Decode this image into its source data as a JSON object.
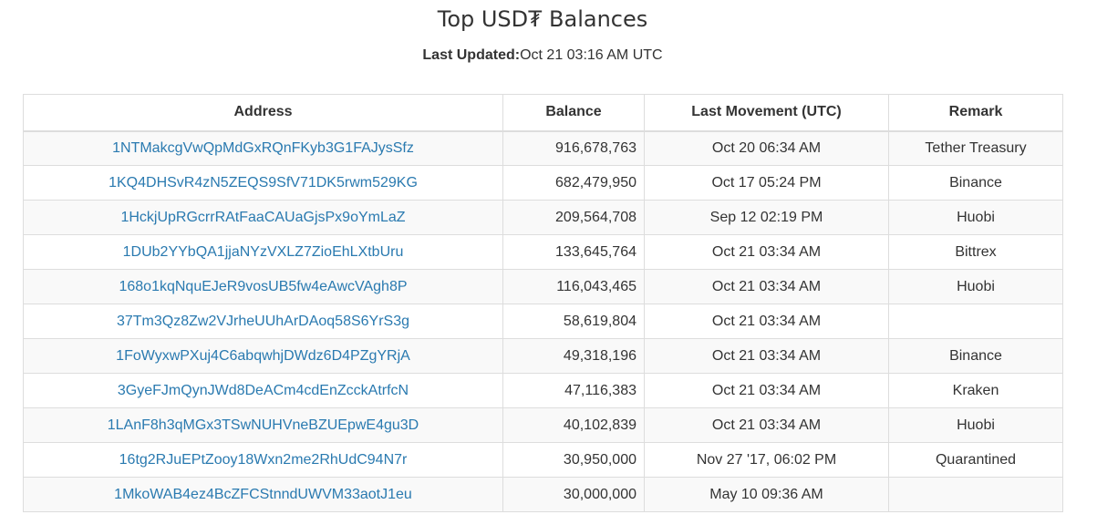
{
  "page": {
    "title": "Top USD₮ Balances",
    "updated_label": "Last Updated:",
    "updated_value": "Oct 21 03:16 AM UTC"
  },
  "table": {
    "headers": [
      "Address",
      "Balance",
      "Last Movement (UTC)",
      "Remark"
    ],
    "rows": [
      {
        "address": "1NTMakcgVwQpMdGxRQnFKyb3G1FAJysSfz",
        "balance": "916,678,763",
        "last_movement": "Oct 20 06:34 AM",
        "remark": "Tether Treasury"
      },
      {
        "address": "1KQ4DHSvR4zN5ZEQS9SfV71DK5rwm529KG",
        "balance": "682,479,950",
        "last_movement": "Oct 17 05:24 PM",
        "remark": "Binance"
      },
      {
        "address": "1HckjUpRGcrrRAtFaaCAUaGjsPx9oYmLaZ",
        "balance": "209,564,708",
        "last_movement": "Sep 12 02:19 PM",
        "remark": "Huobi"
      },
      {
        "address": "1DUb2YYbQA1jjaNYzVXLZ7ZioEhLXtbUru",
        "balance": "133,645,764",
        "last_movement": "Oct 21 03:34 AM",
        "remark": "Bittrex"
      },
      {
        "address": "168o1kqNquEJeR9vosUB5fw4eAwcVAgh8P",
        "balance": "116,043,465",
        "last_movement": "Oct 21 03:34 AM",
        "remark": "Huobi"
      },
      {
        "address": "37Tm3Qz8Zw2VJrheUUhArDAoq58S6YrS3g",
        "balance": "58,619,804",
        "last_movement": "Oct 21 03:34 AM",
        "remark": ""
      },
      {
        "address": "1FoWyxwPXuj4C6abqwhjDWdz6D4PZgYRjA",
        "balance": "49,318,196",
        "last_movement": "Oct 21 03:34 AM",
        "remark": "Binance"
      },
      {
        "address": "3GyeFJmQynJWd8DeACm4cdEnZcckAtrfcN",
        "balance": "47,116,383",
        "last_movement": "Oct 21 03:34 AM",
        "remark": "Kraken"
      },
      {
        "address": "1LAnF8h3qMGx3TSwNUHVneBZUEpwE4gu3D",
        "balance": "40,102,839",
        "last_movement": "Oct 21 03:34 AM",
        "remark": "Huobi"
      },
      {
        "address": "16tg2RJuEPtZooy18Wxn2me2RhUdC94N7r",
        "balance": "30,950,000",
        "last_movement": "Nov 27 '17, 06:02 PM",
        "remark": "Quarantined"
      },
      {
        "address": "1MkoWAB4ez4BcZFCStnndUWVM33aotJ1eu",
        "balance": "30,000,000",
        "last_movement": "May 10 09:36 AM",
        "remark": ""
      }
    ]
  },
  "colors": {
    "link": "#2a7ab0",
    "border": "#dddddd",
    "stripe": "#f9f9f9",
    "text": "#333333"
  }
}
